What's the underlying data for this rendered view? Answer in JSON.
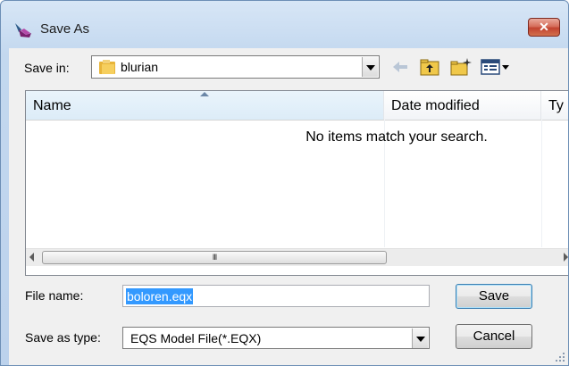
{
  "window": {
    "title": "Save As",
    "close_label": "✕",
    "app_icon": "pen-icon"
  },
  "save_in": {
    "label": "Save in:",
    "value": "blurian",
    "icon": "folder-icon"
  },
  "toolbar": {
    "icons": [
      "back-arrow-icon",
      "up-folder-icon",
      "new-folder-icon",
      "view-menu-icon"
    ]
  },
  "file_list": {
    "columns": [
      "Name",
      "Date modified",
      "Ty"
    ],
    "empty_message": "No items match your search.",
    "scroll_thumb_label": "III"
  },
  "file_name": {
    "label": "File name:",
    "value": "boloren.eqx"
  },
  "save_as_type": {
    "label": "Save as type:",
    "value": "EQS Model File(*.EQX)"
  },
  "buttons": {
    "save": "Save",
    "cancel": "Cancel"
  },
  "colors": {
    "selection": "#3399ff",
    "close_button": "#c24330",
    "title_bar": "#c3d8ef"
  }
}
